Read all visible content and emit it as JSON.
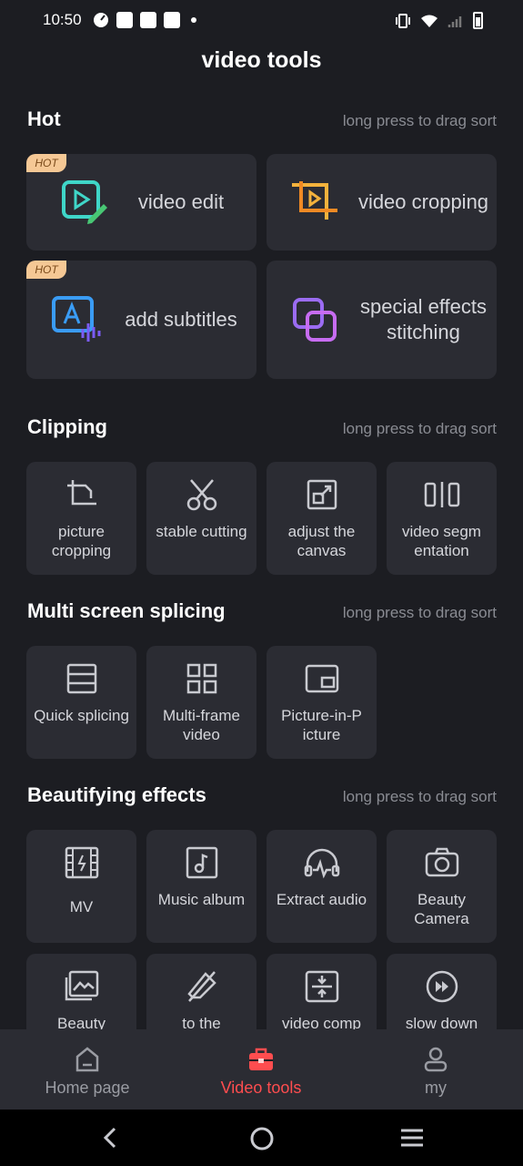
{
  "status_bar": {
    "time": "10:50",
    "left_icons": [
      "speed-icon",
      "mail-icon",
      "mail-icon",
      "mail-icon",
      "dot-icon"
    ],
    "right_icons": [
      "vibrate-icon",
      "wifi-icon",
      "signal-icon",
      "battery-icon"
    ]
  },
  "header": {
    "title": "video tools"
  },
  "sections": {
    "hot": {
      "title": "Hot",
      "hint": "long press to drag sort",
      "items": [
        {
          "label": "video edit",
          "badge": "HOT",
          "icon": "video-edit-icon"
        },
        {
          "label": "video cropping",
          "badge": "",
          "icon": "video-crop-icon"
        },
        {
          "label": "add subtitles",
          "badge": "HOT",
          "icon": "subtitles-icon"
        },
        {
          "label": "special effects stitching",
          "badge": "",
          "icon": "effects-stitch-icon"
        }
      ]
    },
    "clipping": {
      "title": "Clipping",
      "hint": "long press to drag sort",
      "items": [
        {
          "label": "picture cropping",
          "icon": "crop-icon"
        },
        {
          "label": "stable cutting",
          "icon": "scissors-icon"
        },
        {
          "label": "adjust the canvas",
          "icon": "canvas-icon"
        },
        {
          "label": "video segm entation",
          "icon": "segment-icon"
        }
      ]
    },
    "splicing": {
      "title": "Multi screen splicing",
      "hint": "long press to drag sort",
      "items": [
        {
          "label": "Quick splicing",
          "icon": "quick-splice-icon"
        },
        {
          "label": "Multi-frame video",
          "icon": "multiframe-icon"
        },
        {
          "label": "Picture-in-P icture",
          "icon": "pip-icon"
        }
      ]
    },
    "beautifying": {
      "title": "Beautifying effects",
      "hint": "long press to drag sort",
      "items": [
        {
          "label": "MV",
          "icon": "film-icon"
        },
        {
          "label": "Music album",
          "icon": "music-album-icon"
        },
        {
          "label": "Extract audio",
          "icon": "headphones-icon"
        },
        {
          "label": "Beauty Camera",
          "icon": "camera-icon"
        },
        {
          "label": "Beauty",
          "icon": "image-icon"
        },
        {
          "label": "to the",
          "icon": "eraser-icon"
        },
        {
          "label": "video comp",
          "icon": "compress-icon"
        },
        {
          "label": "slow down",
          "icon": "fast-forward-icon"
        }
      ]
    }
  },
  "bottom_nav": {
    "items": [
      {
        "label": "Home page",
        "icon": "home-icon",
        "active": false
      },
      {
        "label": "Video tools",
        "icon": "toolbox-icon",
        "active": true
      },
      {
        "label": "my",
        "icon": "user-icon",
        "active": false
      }
    ]
  },
  "colors": {
    "accent": "#ff4d4f",
    "card": "#2b2c33",
    "bg": "#1c1d22",
    "hot_badge": "#f5c895"
  }
}
